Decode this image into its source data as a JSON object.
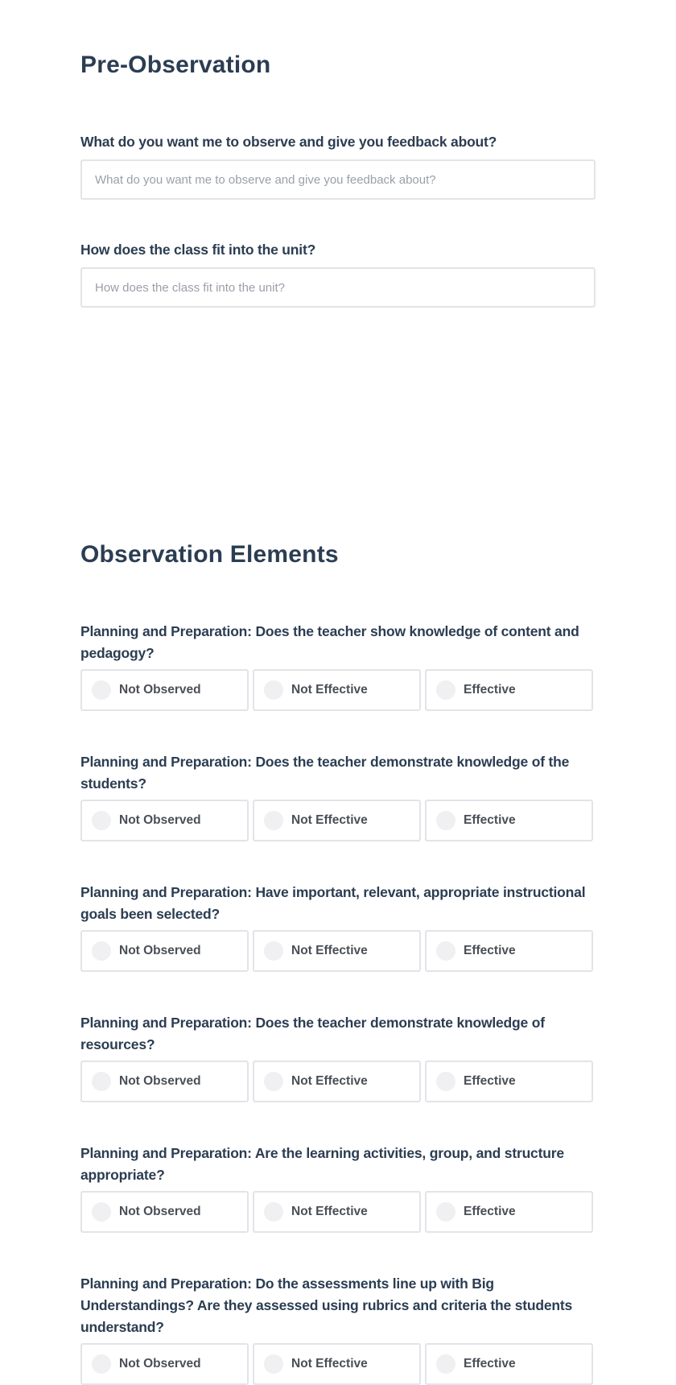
{
  "pre_observation": {
    "title": "Pre-Observation",
    "fields": [
      {
        "label": "What do you want me to observe and give you feedback about?",
        "value": "",
        "placeholder": "What do you want me to observe and give you feedback about?"
      },
      {
        "label": "How does the class fit into the unit?",
        "value": "",
        "placeholder": "How does the class fit into the unit?"
      }
    ]
  },
  "observation_elements": {
    "title": "Observation Elements",
    "options": [
      "Not Observed",
      "Not Effective",
      "Effective"
    ],
    "questions": [
      {
        "label": "Planning and Preparation: Does the teacher show knowledge of content and pedagogy?",
        "selected": null
      },
      {
        "label": "Planning and Preparation: Does the teacher demonstrate knowledge of the students?",
        "selected": null
      },
      {
        "label": "Planning and Preparation: Have important, relevant, appropriate instructional goals been selected?",
        "selected": null
      },
      {
        "label": "Planning and Preparation: Does the teacher demonstrate knowledge of resources?",
        "selected": null
      },
      {
        "label": "Planning and Preparation: Are the learning activities, group, and structure appropriate?",
        "selected": null
      },
      {
        "label": "Planning and Preparation: Do the assessments line up with Big Understandings? Are they assessed using rubrics and criteria the students understand?",
        "selected": null
      }
    ]
  }
}
